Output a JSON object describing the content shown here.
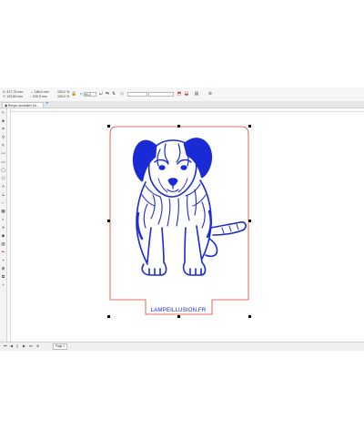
{
  "propbar": {
    "x_label": "X:",
    "x_value": "417,75 mm",
    "y_label": "Y:",
    "y_value": "123,80 mm",
    "w_value": "186,0 mm",
    "h_value": "230,5 mm",
    "scale_w": "100,0",
    "scale_h": "100,0",
    "pct": "%",
    "angle": "90,0"
  },
  "document": {
    "tab_title": "Berger australien 6lL...",
    "add_tab": "+"
  },
  "canvas": {
    "caption": "LAMPEILLUSION.FR"
  },
  "statusbar": {
    "page_tab": "Page 1"
  },
  "colors": {
    "artwork": "#1a2bd6",
    "outline": "#e0402f"
  }
}
